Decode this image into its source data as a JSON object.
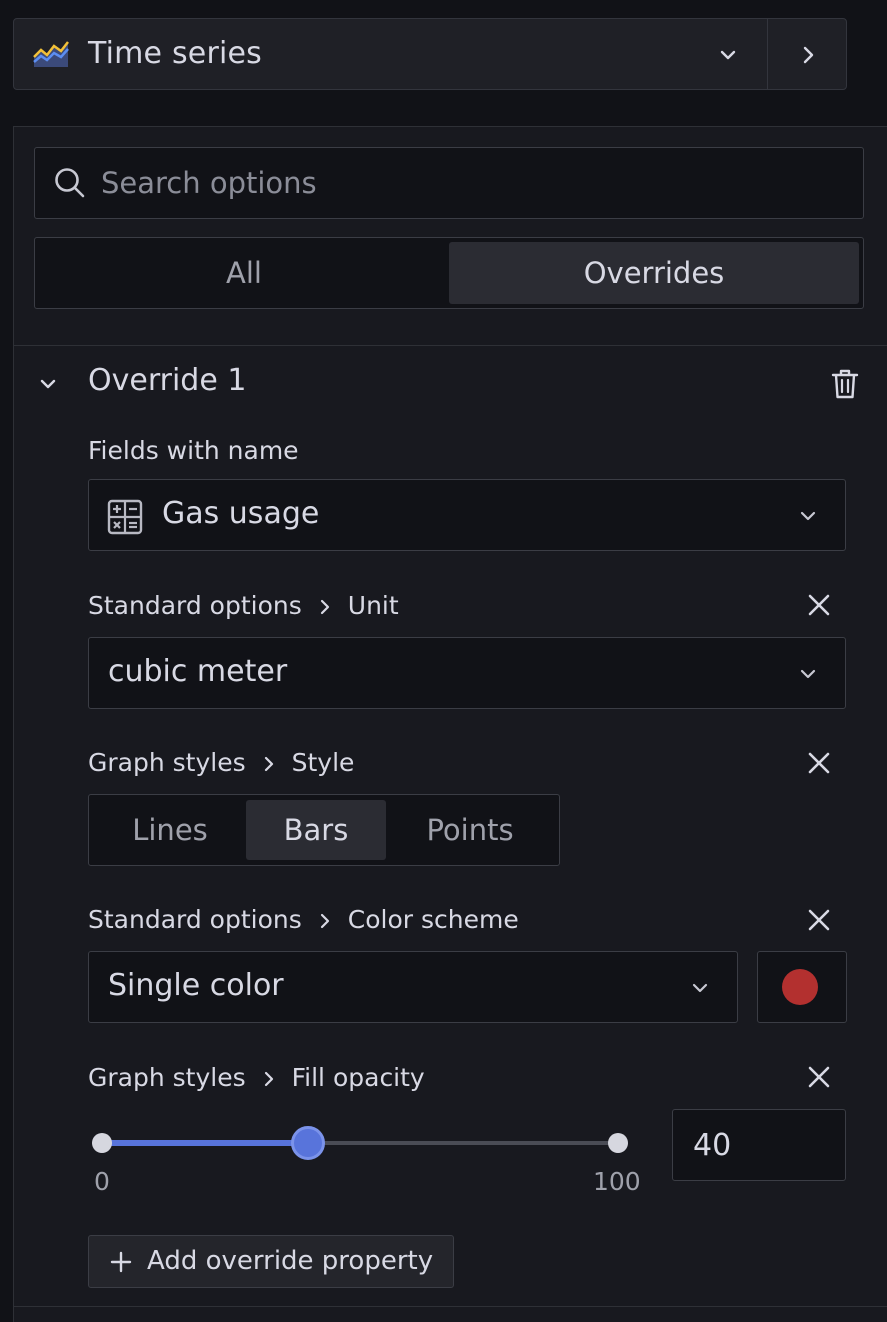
{
  "visualization": {
    "title": "Time series",
    "icon": "time-series-icon"
  },
  "search": {
    "placeholder": "Search options",
    "value": ""
  },
  "tabs": [
    {
      "label": "All",
      "active": false
    },
    {
      "label": "Overrides",
      "active": true
    }
  ],
  "override": {
    "title": "Override 1",
    "matcher": {
      "label": "Fields with name",
      "value": "Gas usage",
      "icon": "calculator-icon"
    },
    "properties": [
      {
        "category": "Standard options",
        "name": "Unit",
        "value": "cubic meter"
      },
      {
        "category": "Graph styles",
        "name": "Style",
        "options": [
          "Lines",
          "Bars",
          "Points"
        ],
        "selected": "Bars"
      },
      {
        "category": "Standard options",
        "name": "Color scheme",
        "value": "Single color",
        "color": "#b3302f"
      },
      {
        "category": "Graph styles",
        "name": "Fill opacity",
        "min": "0",
        "max": "100",
        "value": "40"
      }
    ],
    "add_property_label": "Add override property"
  },
  "colors": {
    "accent": "#5874db",
    "swatch": "#b3302f",
    "background": "#111217",
    "pane": "#18191f"
  }
}
